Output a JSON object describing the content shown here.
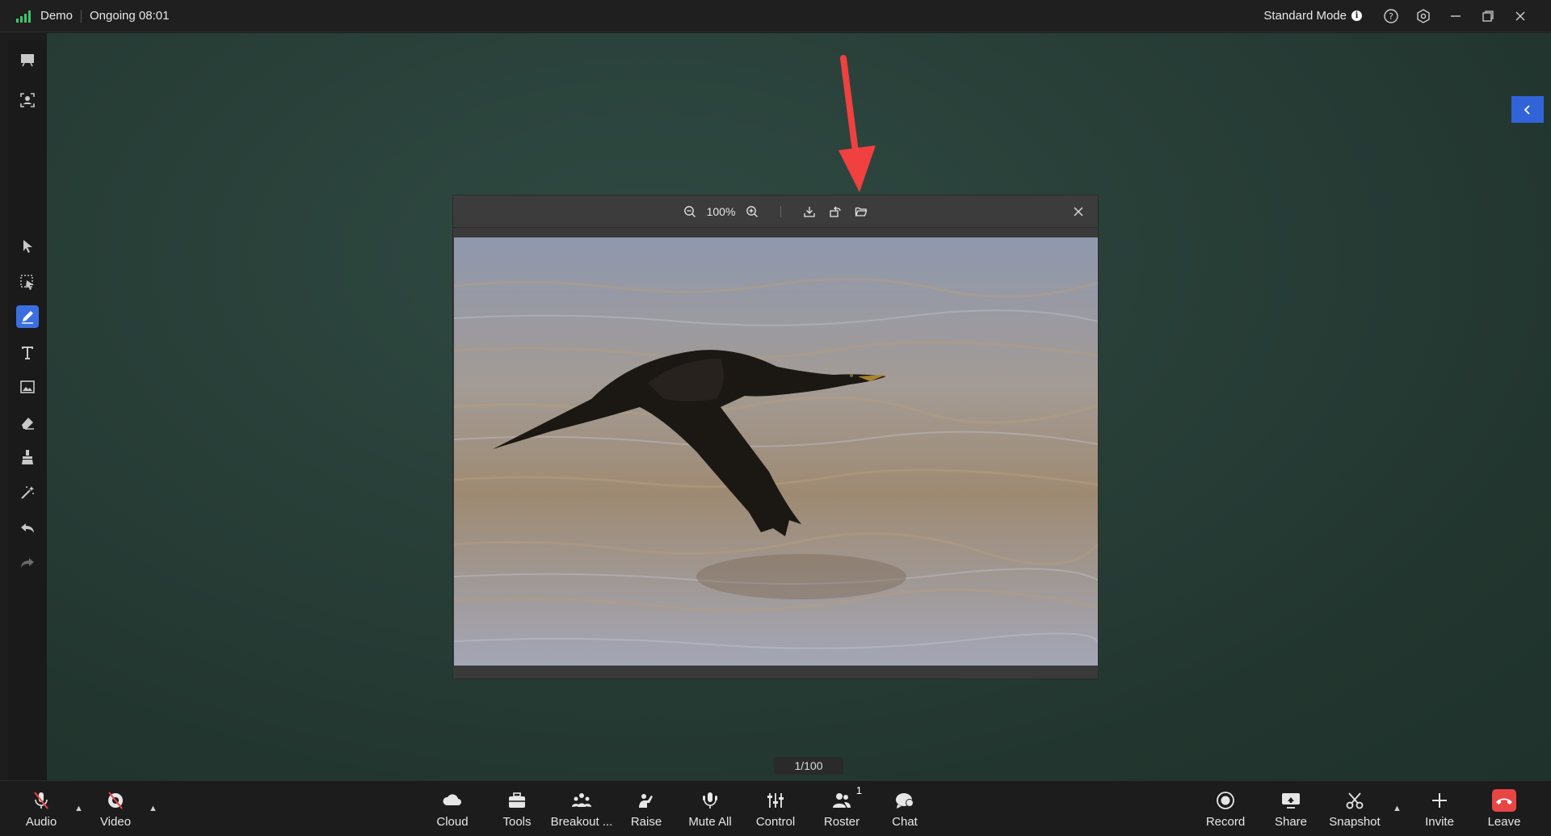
{
  "titlebar": {
    "meeting_name": "Demo",
    "status": "Ongoing 08:01",
    "mode_label": "Standard Mode",
    "icons": [
      "help-icon",
      "settings-icon",
      "minimize-icon",
      "restore-icon",
      "close-icon"
    ]
  },
  "viewer": {
    "zoom": "100%",
    "icons": [
      "zoom-out-icon",
      "zoom-in-icon",
      "download-icon",
      "rotate-icon",
      "open-folder-icon",
      "close-icon"
    ]
  },
  "page_indicator": "1/100",
  "leftbar": {
    "icons": [
      "whiteboard-icon",
      "face-frame-icon",
      "pointer-icon",
      "select-icon",
      "pen-icon",
      "text-icon",
      "image-icon",
      "eraser-icon",
      "brush-clear-icon",
      "magic-wand-icon",
      "undo-icon",
      "redo-icon"
    ],
    "active": "pen-icon"
  },
  "bottombar": {
    "audio": "Audio",
    "video": "Video",
    "cloud": "Cloud",
    "tools": "Tools",
    "breakout": "Breakout ...",
    "raise": "Raise",
    "mute_all": "Mute All",
    "control": "Control",
    "roster": "Roster",
    "roster_count": "1",
    "chat": "Chat",
    "record": "Record",
    "share": "Share",
    "snapshot": "Snapshot",
    "invite": "Invite",
    "leave": "Leave"
  },
  "colors": {
    "accent": "#3b6fe0",
    "board": "#283f38",
    "leave": "#e84545",
    "signal": "#3bc66a",
    "annotation_arrow": "#f04040"
  }
}
